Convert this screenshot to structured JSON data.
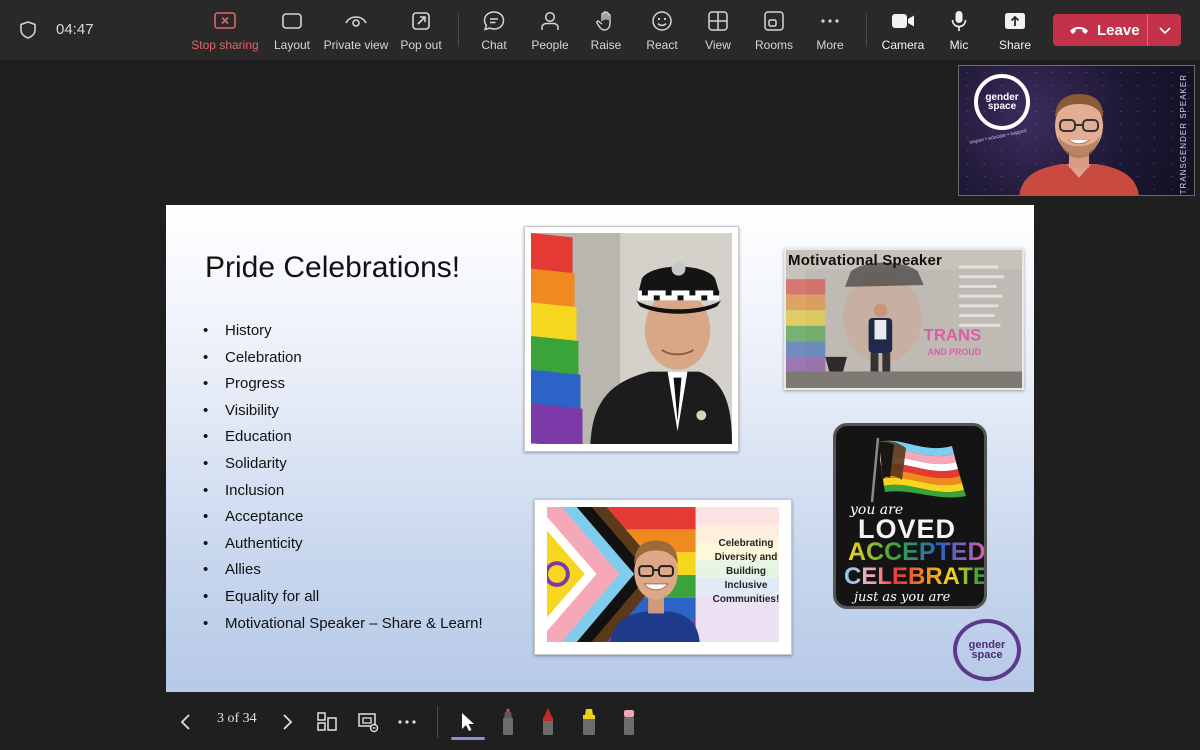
{
  "header": {
    "timer": "04:47",
    "toolbar": [
      {
        "id": "stop-sharing",
        "label": "Stop sharing",
        "icon": "stop-share-icon"
      },
      {
        "id": "layout",
        "label": "Layout",
        "icon": "layout-icon"
      },
      {
        "id": "private-view",
        "label": "Private view",
        "icon": "eye-icon"
      },
      {
        "id": "pop-out",
        "label": "Pop out",
        "icon": "pop-out-icon"
      },
      {
        "id": "chat",
        "label": "Chat",
        "icon": "chat-icon"
      },
      {
        "id": "people",
        "label": "People",
        "icon": "people-icon"
      },
      {
        "id": "raise",
        "label": "Raise",
        "icon": "hand-icon"
      },
      {
        "id": "react",
        "label": "React",
        "icon": "smiley-icon"
      },
      {
        "id": "view",
        "label": "View",
        "icon": "grid-icon"
      },
      {
        "id": "rooms",
        "label": "Rooms",
        "icon": "rooms-icon"
      },
      {
        "id": "more",
        "label": "More",
        "icon": "more-icon"
      },
      {
        "id": "camera",
        "label": "Camera",
        "icon": "camera-icon"
      },
      {
        "id": "mic",
        "label": "Mic",
        "icon": "mic-icon"
      },
      {
        "id": "share",
        "label": "Share",
        "icon": "share-icon"
      }
    ],
    "leave_label": "Leave",
    "colors": {
      "leave": "#c4314b",
      "stop_sharing": "#e8626a"
    }
  },
  "video": {
    "logo_line1": "gender",
    "logo_line2": "space",
    "tagline": "inspire • educate • support",
    "side_text": "TRANSGENDER SPEAKER"
  },
  "slide": {
    "title": "Pride Celebrations!",
    "bullets": [
      "History",
      "Celebration",
      "Progress",
      "Visibility",
      "Education",
      "Solidarity",
      "Inclusion",
      "Acceptance",
      "Authenticity",
      "Allies",
      "Equality for all",
      "Motivational Speaker – Share & Learn!"
    ],
    "photo2_title": "Motivational Speaker",
    "photo2_overlay": "TRANS",
    "photo2_overlay2": "AND PROUD",
    "photo3_lines": [
      "Celebrating",
      "Diversity and",
      "Building",
      "Inclusive",
      "Communities!"
    ],
    "badge": {
      "you_are": "you are",
      "loved": "LOVED",
      "accepted": "ACCEPTED",
      "amp": "&",
      "celebrated": "CELEBRATED",
      "just": "just as you are"
    },
    "logo_line1": "gender",
    "logo_line2": "space"
  },
  "presenter": {
    "page_label": "3 of 34"
  }
}
